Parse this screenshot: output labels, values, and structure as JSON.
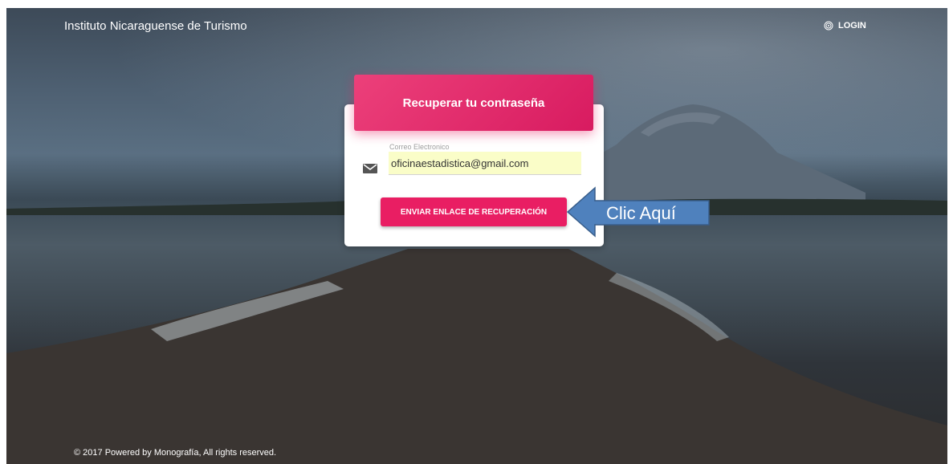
{
  "header": {
    "title": "Instituto Nicaraguense de Turismo",
    "login_label": "LOGIN",
    "login_icon": "fingerprint-icon"
  },
  "card": {
    "title": "Recuperar tu contraseña",
    "email_label": "Correo Electronico",
    "email_value": "oficinaestadistica@gmail.com",
    "email_icon": "mail-icon",
    "submit_label": "ENVIAR ENLACE DE RECUPERACIÓN"
  },
  "annotation": {
    "callout_text": "Clic Aquí",
    "arrow_color": "#4f81bd"
  },
  "footer": {
    "text": "© 2017 Powered by Monografía, All rights reserved."
  },
  "colors": {
    "accent": "#e91e63",
    "input_autofill": "#fafdc8"
  }
}
